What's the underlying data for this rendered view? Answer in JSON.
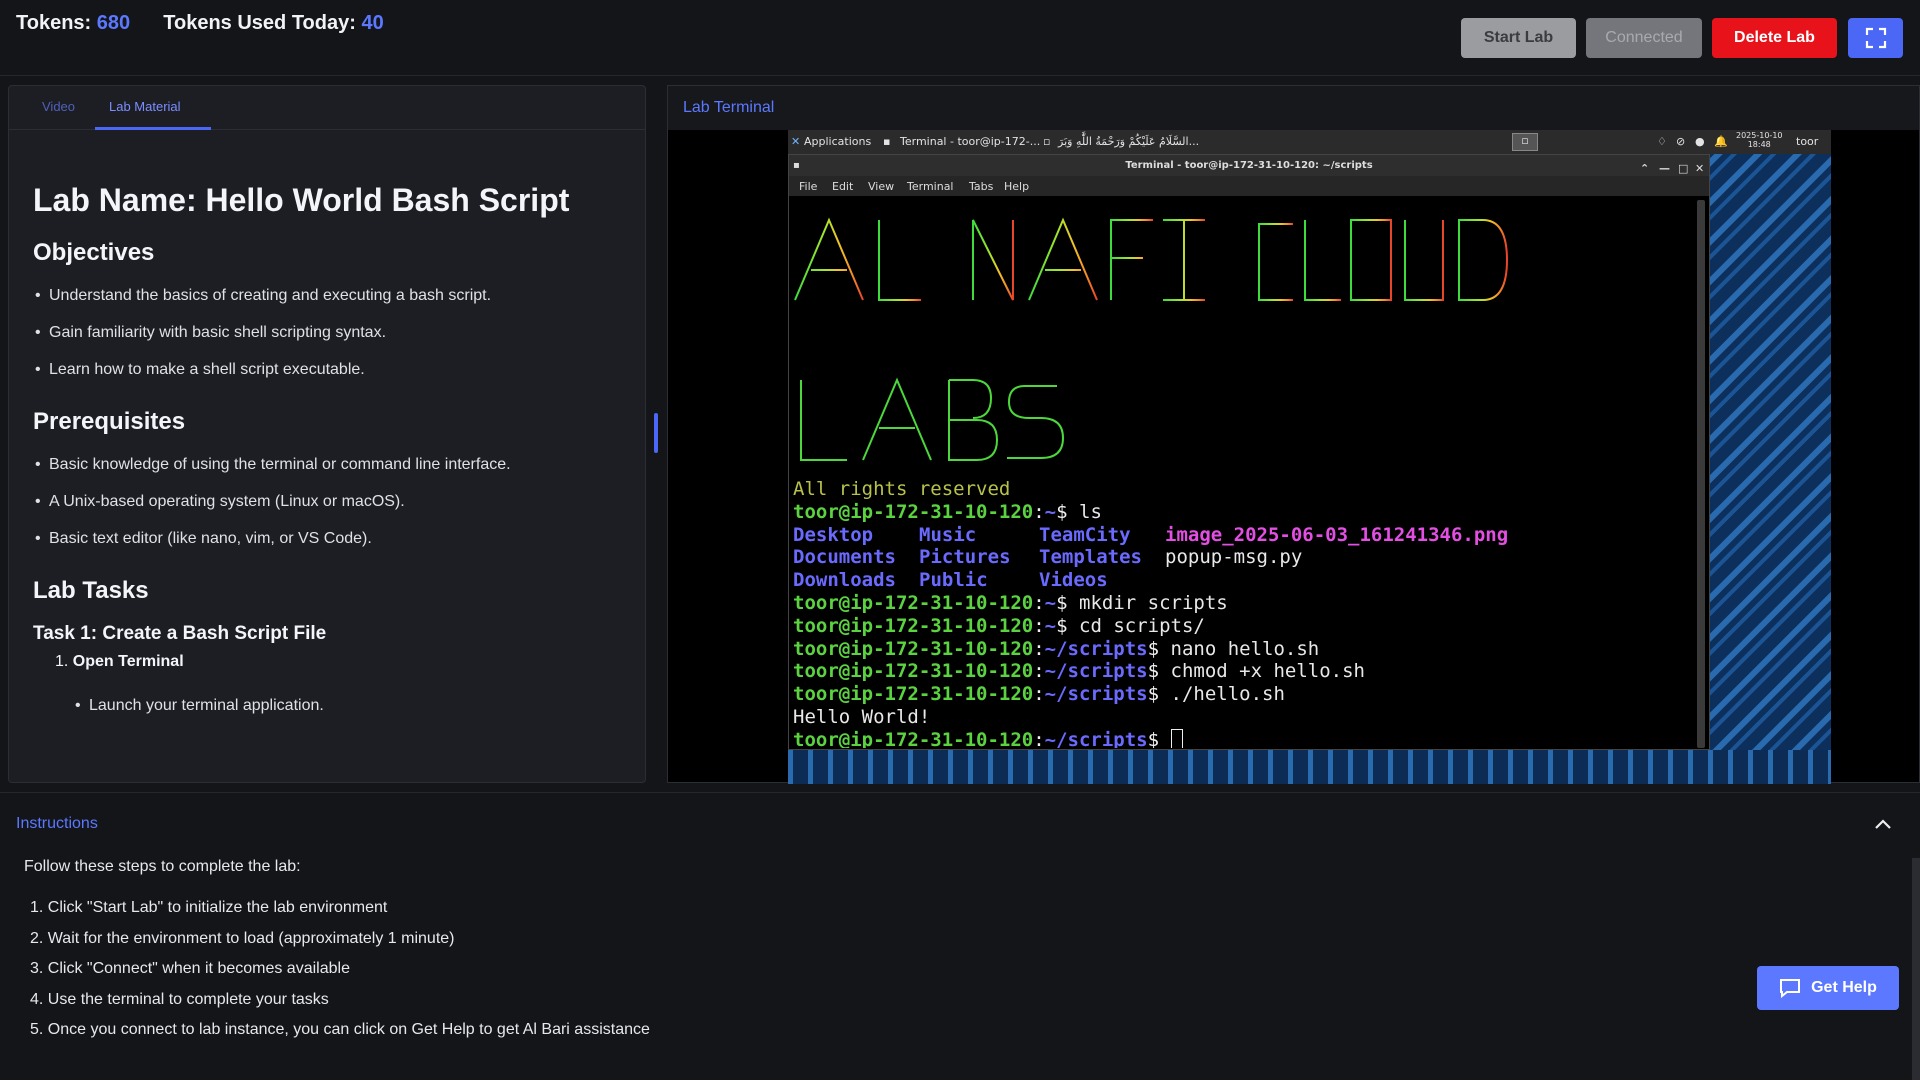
{
  "header": {
    "tokens_label": "Tokens:",
    "tokens_value": "680",
    "tokens_today_label": "Tokens Used Today:",
    "tokens_today_value": "40",
    "start_lab": "Start Lab",
    "connected": "Connected",
    "delete_lab": "Delete Lab",
    "fullscreen_icon": "expand-icon"
  },
  "left": {
    "tabs": [
      {
        "label": "Video",
        "active": false
      },
      {
        "label": "Lab Material",
        "active": true
      }
    ],
    "lab_name": "Lab Name: Hello World Bash Script",
    "objectives_heading": "Objectives",
    "objectives": [
      "Understand the basics of creating and executing a bash script.",
      "Gain familiarity with basic shell scripting syntax.",
      "Learn how to make a shell script executable."
    ],
    "prereq_heading": "Prerequisites",
    "prerequisites": [
      "Basic knowledge of using the terminal or command line interface.",
      "A Unix-based operating system (Linux or macOS).",
      "Basic text editor (like nano, vim, or VS Code)."
    ],
    "tasks_heading": "Lab Tasks",
    "task1_heading": "Task 1: Create a Bash Script File",
    "task1_step_num": "1.",
    "task1_step": "Open Terminal",
    "task1_sub": "Launch your terminal application."
  },
  "right": {
    "title": "Lab Terminal",
    "panel": {
      "applications": "Applications",
      "task_terminal": "Terminal - toor@ip-172-...",
      "task_arabic": "السَّلَامُ عَلَيْكُمْ وَرَحْمَةُ اللَّٰهِ وَبَرَ...",
      "date": "2025-10-10",
      "time": "18:48",
      "user": "toor"
    },
    "window_title": "Terminal - toor@ip-172-31-10-120: ~/scripts",
    "menu": [
      "File",
      "Edit",
      "View",
      "Terminal",
      "Tabs",
      "Help"
    ],
    "rights": "All rights reserved",
    "prompt_user": "toor@ip-172-31-10-120",
    "home": "~",
    "scripts_dir": "~/scripts",
    "cmd_ls": "ls",
    "ls_dirs": [
      "Desktop",
      "Music",
      "TeamCity",
      "Documents",
      "Pictures",
      "Templates",
      "Downloads",
      "Public",
      "Videos"
    ],
    "ls_image": "image_2025-06-03_161241346.png",
    "ls_file": "popup-msg.py",
    "cmd_mkdir": "mkdir scripts",
    "cmd_cd": "cd scripts/",
    "cmd_nano": "nano hello.sh",
    "cmd_chmod": "chmod +x hello.sh",
    "cmd_run": "./hello.sh",
    "output": "Hello World!"
  },
  "instructions": {
    "title": "Instructions",
    "intro": "Follow these steps to complete the lab:",
    "steps": [
      "1. Click \"Start Lab\" to initialize the lab environment",
      "2. Wait for the environment to load (approximately 1 minute)",
      "3. Click \"Connect\" when it becomes available",
      "4. Use the terminal to complete your tasks",
      "5. Once you connect to lab instance, you can click on Get Help to get Al Bari assistance"
    ]
  },
  "help": {
    "label": "Get Help",
    "icon": "chat-icon"
  }
}
